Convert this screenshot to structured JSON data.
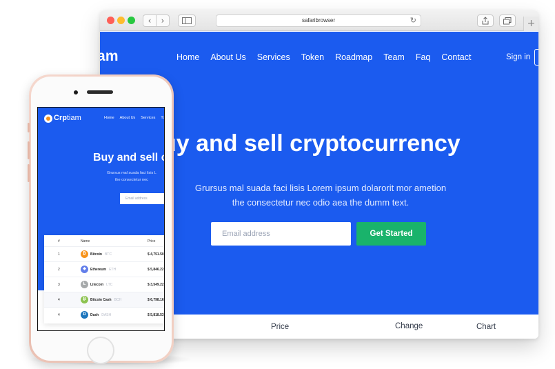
{
  "browser": {
    "address": "safaribrowser",
    "icons": {
      "back": "chevron-left-icon",
      "forward": "chevron-right-icon",
      "sidebar": "sidebar-icon",
      "reload": "reload-icon",
      "share": "share-icon",
      "tabs": "tabs-icon",
      "new_tab": "plus-icon"
    }
  },
  "site": {
    "logo_partial": "iam",
    "nav": [
      "Home",
      "About Us",
      "Services",
      "Token",
      "Roadmap",
      "Team",
      "Faq",
      "Contact"
    ],
    "signin": "Sign in",
    "headline": "uy and sell cryptocurrency",
    "subtitle_line1": "Grursus mal suada faci lisis Lorem ipsum dolarorit mor ametion",
    "subtitle_line2": "the consectetur nec odio aea the dumm text.",
    "email_placeholder": "Email address",
    "cta": "Get Started",
    "table_headers": {
      "price": "Price",
      "change": "Change",
      "chart": "Chart"
    },
    "accent": "#1b5bef",
    "cta_color": "#19b36b"
  },
  "mobile": {
    "logo_bold": "Crp",
    "logo_rest": "tiam",
    "nav": [
      "Home",
      "About Us",
      "Services",
      "To"
    ],
    "headline": "Buy and sell c",
    "subtitle_line1": "Grursus mal suada faci lisis L",
    "subtitle_line2": "the consectetur nec",
    "email_placeholder": "Email address",
    "table_headers": {
      "num": "#",
      "name": "Name",
      "price": "Price"
    },
    "rows": [
      {
        "num": "1",
        "name": "Bitcoin",
        "symbol": "BTC",
        "price": "$ 4,751.50",
        "icon": "bitcoin-icon",
        "color": "#f7931a",
        "glyph": "₿"
      },
      {
        "num": "2",
        "name": "Ethereum",
        "symbol": "ETH",
        "price": "$ 5,846.22",
        "icon": "ethereum-icon",
        "color": "#627eea",
        "glyph": "◆"
      },
      {
        "num": "3",
        "name": "Litecoin",
        "symbol": "LTC",
        "price": "$ 3,549.22",
        "icon": "litecoin-icon",
        "color": "#a6a9aa",
        "glyph": "Ł"
      },
      {
        "num": "4",
        "name": "Bitcoin Cash",
        "symbol": "BCH",
        "price": "$ 6,798.16",
        "icon": "bitcoin-cash-icon",
        "color": "#8dc351",
        "glyph": "₿"
      },
      {
        "num": "4",
        "name": "Dash",
        "symbol": "DASH",
        "price": "$ 5,818.53",
        "icon": "dash-icon",
        "color": "#1c75bc",
        "glyph": "D"
      }
    ]
  }
}
